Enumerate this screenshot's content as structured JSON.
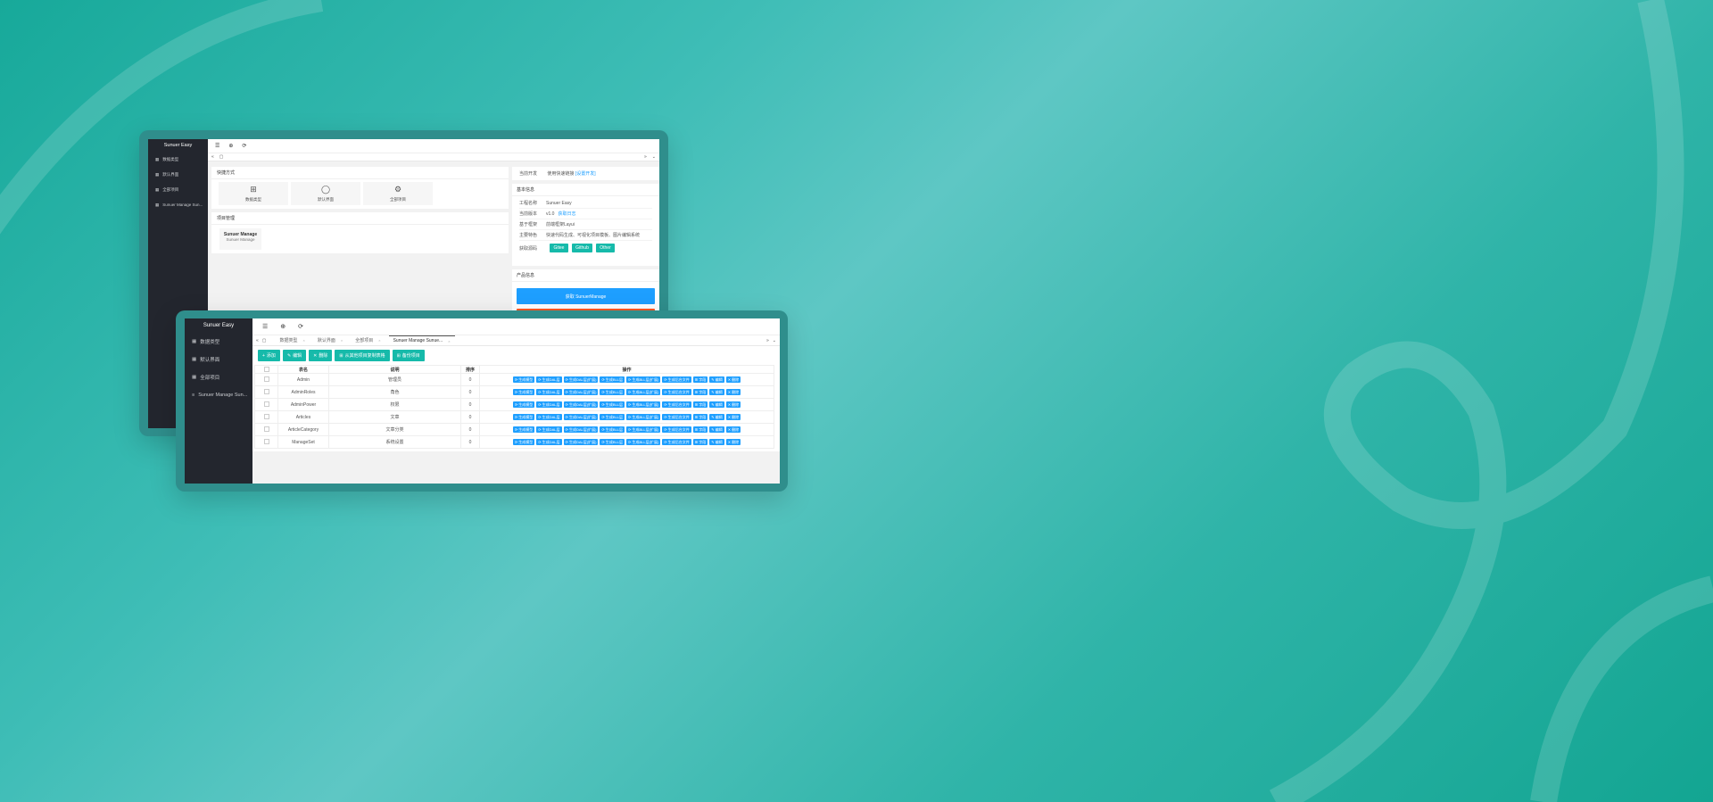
{
  "colors": {
    "accent": "#16baaa",
    "blue": "#1e9fff",
    "orange": "#ff5722",
    "sidebar": "#23262e"
  },
  "back": {
    "brand": "Sunuer Easy",
    "sidebar": [
      {
        "icon": "table-icon",
        "label": "数据类型"
      },
      {
        "icon": "table-icon",
        "label": "默认界面"
      },
      {
        "icon": "table-icon",
        "label": "全部项目"
      },
      {
        "icon": "table-icon",
        "label": "Sunuer Manage Sun..."
      }
    ],
    "toolbar": [
      "☰",
      "⊕",
      "⟳"
    ],
    "shortcuts": {
      "title": "快捷方式",
      "items": [
        {
          "icon": "grid-plus-icon",
          "label": "数据类型"
        },
        {
          "icon": "user-icon",
          "label": "默认界面"
        },
        {
          "icon": "gear-icon",
          "label": "全部项目"
        }
      ]
    },
    "projects": {
      "title": "项目管理",
      "item_title": "Sunuer Manage",
      "item_sub": "Sunuer Manage"
    },
    "info": {
      "row1_label": "当前开发",
      "row1_value": "使用快速链接",
      "row1_link": "[设置开发]",
      "title": "基本信息",
      "rows": [
        {
          "label": "工程名称",
          "value": "Sunuer Easy"
        },
        {
          "label": "当前版本",
          "value": "v1.0",
          "link": "获取日志"
        },
        {
          "label": "基于框架",
          "value": "前端框架Layui"
        },
        {
          "label": "主要特色",
          "value": "快速代码生成、可视化项目模板、图片编辑系统"
        }
      ],
      "download_label": "获取源码",
      "download_buttons": [
        "Gitee",
        "Github",
        "Other"
      ]
    },
    "product": {
      "title": "产品信息",
      "button": "获取 SunuerManage"
    }
  },
  "front": {
    "brand": "Sunuer Easy",
    "sidebar": [
      {
        "icon": "table-icon",
        "label": "数据类型"
      },
      {
        "icon": "table-icon",
        "label": "默认界面"
      },
      {
        "icon": "table-icon",
        "label": "全部项目"
      },
      {
        "icon": "list-icon",
        "label": "Sunuer Manage Sun..."
      }
    ],
    "toolbar": [
      "☰",
      "⊕",
      "⟳"
    ],
    "tabs": [
      "数据类型",
      "默认界面",
      "全部项目",
      "Sunuer Manage Sunue..."
    ],
    "actions": [
      {
        "icon": "+",
        "label": "添加"
      },
      {
        "icon": "✎",
        "label": "编辑"
      },
      {
        "icon": "✕",
        "label": "删除"
      },
      {
        "icon": "⊞",
        "label": "从其他项目复制表格"
      },
      {
        "icon": "⊞",
        "label": "备份项目"
      }
    ],
    "table": {
      "headers": [
        "",
        "表名",
        "说明",
        "排序",
        "操作"
      ],
      "rows": [
        {
          "name": "Admin",
          "desc": "管理员",
          "sort": "0"
        },
        {
          "name": "AdminRoles",
          "desc": "角色",
          "sort": "0"
        },
        {
          "name": "AdminPower",
          "desc": "权限",
          "sort": "0"
        },
        {
          "name": "Articles",
          "desc": "文章",
          "sort": "0"
        },
        {
          "name": "ArticleCategory",
          "desc": "文章分类",
          "sort": "0"
        },
        {
          "name": "ManageSet",
          "desc": "系统设置",
          "sort": "0"
        }
      ],
      "ops": [
        "⟳ 生成模型",
        "⟳ 生成DAL层",
        "⟳ 生成DAL层(扩展)",
        "⟳ 生成BLL层",
        "⟳ 生成BLL层(扩展)",
        "⟳ 生成后台文件",
        "⊞ 字段",
        "✎ 编辑",
        "✕ 删除"
      ]
    }
  }
}
